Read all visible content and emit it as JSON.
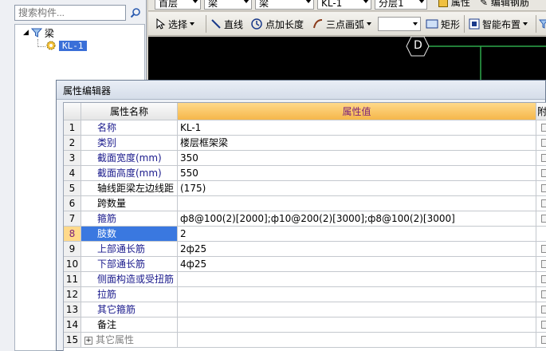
{
  "tree_panel": {
    "search_placeholder": "搜索构件...",
    "root_label": "梁",
    "child_label": "KL-1"
  },
  "toolbar_top": {
    "floor": "首层",
    "category": "梁",
    "type": "梁",
    "component": "KL-1",
    "layer": "分层1",
    "attr_label": "属性",
    "rebar_label": "编辑钢筋"
  },
  "toolbar_draw": {
    "select_label": "选择",
    "line_label": "直线",
    "point_length_label": "点加长度",
    "arc_label": "三点画弧",
    "rect_label": "矩形",
    "smart_label": "智能布置"
  },
  "canvas": {
    "axis_label": "D"
  },
  "dialog": {
    "title": "属性编辑器",
    "col_name": "属性名称",
    "col_value": "属性值",
    "col_attach": "附加",
    "rows": [
      {
        "num": "1",
        "name": "名称",
        "value": "KL-1",
        "blue": true
      },
      {
        "num": "2",
        "name": "类别",
        "value": "楼层框架梁",
        "blue": true
      },
      {
        "num": "3",
        "name": "截面宽度(mm)",
        "value": "350",
        "blue": true
      },
      {
        "num": "4",
        "name": "截面高度(mm)",
        "value": "550",
        "blue": true
      },
      {
        "num": "5",
        "name": "轴线距梁左边线距",
        "value": "(175)",
        "blue": false
      },
      {
        "num": "6",
        "name": "跨数量",
        "value": "",
        "blue": false
      },
      {
        "num": "7",
        "name": "箍筋",
        "value": "ф8@100(2)[2000];ф10@200(2)[3000];ф8@100(2)[3000]",
        "blue": true
      },
      {
        "num": "8",
        "name": "肢数",
        "value": "2",
        "blue": true,
        "selected": true
      },
      {
        "num": "9",
        "name": "上部通长筋",
        "value": "2ф25",
        "blue": true
      },
      {
        "num": "10",
        "name": "下部通长筋",
        "value": "4ф25",
        "blue": true
      },
      {
        "num": "11",
        "name": "侧面构造或受扭筋",
        "value": "",
        "blue": true
      },
      {
        "num": "12",
        "name": "拉筋",
        "value": "",
        "blue": true
      },
      {
        "num": "13",
        "name": "其它箍筋",
        "value": "",
        "blue": true
      },
      {
        "num": "14",
        "name": "备注",
        "value": "",
        "blue": false
      },
      {
        "num": "15",
        "name": "其它属性",
        "value": "",
        "blue": false,
        "expandable": true
      }
    ]
  }
}
